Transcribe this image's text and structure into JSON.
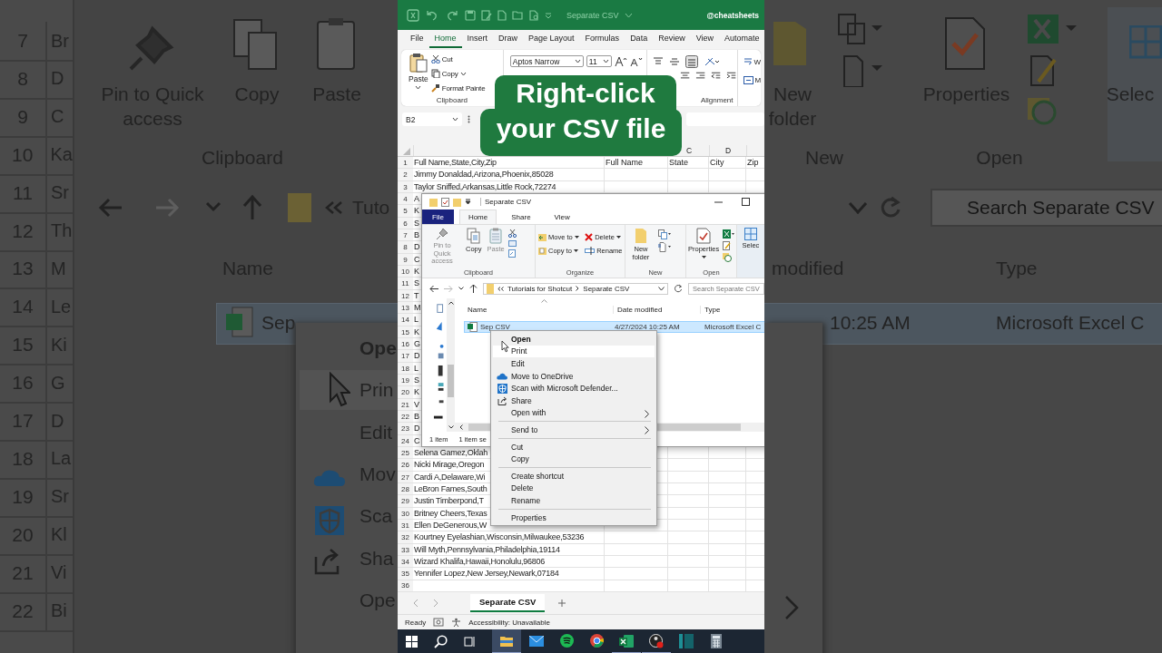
{
  "backdrop_left": {
    "rows": [
      {
        "number": "7",
        "text": "Br"
      },
      {
        "number": "8",
        "text": "D"
      },
      {
        "number": "9",
        "text": "C"
      },
      {
        "number": "10",
        "text": "Ka"
      },
      {
        "number": "11",
        "text": "Sr"
      },
      {
        "number": "12",
        "text": "Th"
      },
      {
        "number": "13",
        "text": "M"
      },
      {
        "number": "14",
        "text": "Le"
      },
      {
        "number": "15",
        "text": "Ki"
      },
      {
        "number": "16",
        "text": "G"
      },
      {
        "number": "17",
        "text": "D"
      },
      {
        "number": "18",
        "text": "La"
      },
      {
        "number": "19",
        "text": "Sr"
      },
      {
        "number": "20",
        "text": "Kl"
      },
      {
        "number": "21",
        "text": "Vi"
      },
      {
        "number": "22",
        "text": "Bi"
      }
    ],
    "labels": [
      "Pin to Quick access",
      "Copy",
      "Paste",
      "Clipboard",
      "Tuto",
      "Name",
      "Sep"
    ],
    "menu_items": [
      {
        "label": "Ope",
        "default": true,
        "highlighted": false
      },
      {
        "label": "Prin",
        "default": false,
        "highlighted": true
      },
      {
        "label": "Edit",
        "default": false,
        "highlighted": false
      },
      {
        "label": "Mov",
        "default": false,
        "highlighted": false
      },
      {
        "label": "Sca",
        "default": false,
        "highlighted": false
      },
      {
        "label": "Sha",
        "default": false,
        "highlighted": false
      },
      {
        "label": "Ope",
        "default": false,
        "highlighted": false
      }
    ]
  },
  "backdrop_right": {
    "labels": [
      "New folder",
      "Properties",
      "Selec",
      "New",
      "Open",
      "modified",
      "Type",
      "10:25 AM",
      "Microsoft Excel C"
    ],
    "search": {
      "placeholder": "Search Separate CSV"
    }
  },
  "excel": {
    "title": "Separate CSV",
    "account": "@cheatsheets",
    "menu_tabs": [
      {
        "label": "File",
        "selected": false
      },
      {
        "label": "Home",
        "selected": true
      },
      {
        "label": "Insert",
        "selected": false
      },
      {
        "label": "Draw",
        "selected": false
      },
      {
        "label": "Page Layout",
        "selected": false
      },
      {
        "label": "Formulas",
        "selected": false
      },
      {
        "label": "Data",
        "selected": false
      },
      {
        "label": "Review",
        "selected": false
      },
      {
        "label": "View",
        "selected": false
      },
      {
        "label": "Automate",
        "selected": false
      }
    ],
    "ribbon": {
      "paste": "Paste",
      "cut": "Cut",
      "copy": "Copy",
      "format_painter": "Format Painte",
      "clipboard_group": "Clipboard",
      "font": "Aptos Narrow",
      "font_size": "11",
      "wrap": "W",
      "merge": "M",
      "alignment_group": "Alignment"
    },
    "name_box": "B2",
    "column_headers": [
      "C",
      "D"
    ],
    "rows": [
      {
        "number": "1",
        "cells": [
          "Full Name,State,City,Zip",
          "Full Name",
          "State",
          "City",
          "Zip"
        ]
      },
      {
        "number": "2",
        "cells": [
          "Jimmy Donaldad,Arizona,Phoenix,85028"
        ]
      },
      {
        "number": "3",
        "cells": [
          "Taylor Sniffed,Arkansas,Little Rock,72274"
        ]
      },
      {
        "number": "4",
        "cells": [
          "A"
        ]
      },
      {
        "number": "5",
        "cells": [
          "K"
        ]
      },
      {
        "number": "6",
        "cells": [
          "S"
        ]
      },
      {
        "number": "7",
        "cells": [
          "B"
        ]
      },
      {
        "number": "8",
        "cells": [
          "D"
        ]
      },
      {
        "number": "9",
        "cells": [
          "C"
        ]
      },
      {
        "number": "10",
        "cells": [
          "K"
        ]
      },
      {
        "number": "11",
        "cells": [
          "S"
        ]
      },
      {
        "number": "12",
        "cells": [
          "T"
        ]
      },
      {
        "number": "13",
        "cells": [
          "M"
        ]
      },
      {
        "number": "14",
        "cells": [
          "L"
        ]
      },
      {
        "number": "15",
        "cells": [
          "K"
        ]
      },
      {
        "number": "16",
        "cells": [
          "G"
        ]
      },
      {
        "number": "17",
        "cells": [
          "D"
        ]
      },
      {
        "number": "18",
        "cells": [
          "L"
        ]
      },
      {
        "number": "19",
        "cells": [
          "S"
        ]
      },
      {
        "number": "20",
        "cells": [
          "K"
        ]
      },
      {
        "number": "21",
        "cells": [
          "V"
        ]
      },
      {
        "number": "22",
        "cells": [
          "B"
        ]
      },
      {
        "number": "23",
        "cells": [
          "D"
        ]
      },
      {
        "number": "24",
        "cells": [
          "C"
        ]
      },
      {
        "number": "25",
        "cells": [
          "Selena Gamez,Oklah"
        ]
      },
      {
        "number": "26",
        "cells": [
          "Nicki Mirage,Oregon"
        ]
      },
      {
        "number": "27",
        "cells": [
          "Cardi A,Delaware,Wi"
        ]
      },
      {
        "number": "28",
        "cells": [
          "LeBron Fames,South"
        ]
      },
      {
        "number": "29",
        "cells": [
          "Justin Timberpond,T"
        ]
      },
      {
        "number": "30",
        "cells": [
          "Britney Cheers,Texas"
        ]
      },
      {
        "number": "31",
        "cells": [
          "Ellen DeGenerous,W"
        ]
      },
      {
        "number": "32",
        "cells": [
          "Kourtney Eyelashian,Wisconsin,Milwaukee,53236"
        ]
      },
      {
        "number": "33",
        "cells": [
          "Will Myth,Pennsylvania,Philadelphia,19114"
        ]
      },
      {
        "number": "34",
        "cells": [
          "Wizard Khalifa,Hawaii,Honolulu,96806"
        ]
      },
      {
        "number": "35",
        "cells": [
          "Yennifer Lopez,New Jersey,Newark,07184"
        ]
      },
      {
        "number": "36",
        "cells": []
      }
    ],
    "sheet_tabs": [
      {
        "label": "Separate CSV",
        "selected": true
      }
    ],
    "status": {
      "ready": "Ready",
      "accessibility": "Accessibility: Unavailable"
    }
  },
  "explorer": {
    "title": "Separate CSV",
    "tabs": [
      {
        "label": "File",
        "kind": "file",
        "selected": false
      },
      {
        "label": "Home",
        "kind": "tab",
        "selected": true
      },
      {
        "label": "Share",
        "kind": "tab",
        "selected": false
      },
      {
        "label": "View",
        "kind": "tab",
        "selected": false
      }
    ],
    "ribbon": {
      "clipboard": {
        "buttons": [
          {
            "label": "Pin to Quick access",
            "disabled": true
          },
          {
            "label": "Copy",
            "disabled": false
          },
          {
            "label": "Paste",
            "disabled": true
          }
        ],
        "label": "Clipboard"
      },
      "organize": {
        "buttons": [
          {
            "label": "Move to",
            "disabled": false
          },
          {
            "label": "Delete",
            "disabled": false
          },
          {
            "label": "Copy to",
            "disabled": false
          },
          {
            "label": "Rename",
            "disabled": false
          }
        ],
        "label": "Organize"
      },
      "new": {
        "buttons": [
          {
            "label": "New folder",
            "disabled": false
          }
        ],
        "label": "New"
      },
      "open": {
        "buttons": [
          {
            "label": "Properties",
            "disabled": false
          }
        ],
        "label": "Open"
      },
      "select": {
        "buttons": [
          {
            "label": "Selec",
            "disabled": false
          }
        ]
      }
    },
    "path": [
      "Tutorials for Shotcut",
      "Separate CSV"
    ],
    "search": {
      "placeholder": "Search Separate CSV"
    },
    "columns": [
      "Name",
      "Date modified",
      "Type"
    ],
    "files": [
      {
        "name": "Sep CSV",
        "date": "4/27/2024 10:25 AM",
        "type": "Microsoft Excel C",
        "selected": true
      }
    ],
    "status": [
      "1 item",
      "1 item se"
    ]
  },
  "context_menu": {
    "items": [
      {
        "kind": "item",
        "label": "Open",
        "default": true,
        "highlighted": false,
        "submenu": false
      },
      {
        "kind": "item",
        "label": "Print",
        "default": false,
        "highlighted": true,
        "submenu": false
      },
      {
        "kind": "item",
        "label": "Edit",
        "default": false,
        "highlighted": false,
        "submenu": false
      },
      {
        "kind": "item",
        "label": "Move to OneDrive",
        "default": false,
        "highlighted": false,
        "submenu": false
      },
      {
        "kind": "item",
        "label": "Scan with Microsoft Defender...",
        "default": false,
        "highlighted": false,
        "submenu": false
      },
      {
        "kind": "item",
        "label": "Share",
        "default": false,
        "highlighted": false,
        "submenu": false
      },
      {
        "kind": "item",
        "label": "Open with",
        "default": false,
        "highlighted": false,
        "submenu": true
      },
      {
        "kind": "separator"
      },
      {
        "kind": "item",
        "label": "Send to",
        "default": false,
        "highlighted": false,
        "submenu": true
      },
      {
        "kind": "separator"
      },
      {
        "kind": "item",
        "label": "Cut",
        "default": false,
        "highlighted": false,
        "submenu": false
      },
      {
        "kind": "item",
        "label": "Copy",
        "default": false,
        "highlighted": false,
        "submenu": false
      },
      {
        "kind": "separator"
      },
      {
        "kind": "item",
        "label": "Create shortcut",
        "default": false,
        "highlighted": false,
        "submenu": false
      },
      {
        "kind": "item",
        "label": "Delete",
        "default": false,
        "highlighted": false,
        "submenu": false
      },
      {
        "kind": "item",
        "label": "Rename",
        "default": false,
        "highlighted": false,
        "submenu": false
      },
      {
        "kind": "separator"
      },
      {
        "kind": "item",
        "label": "Properties",
        "default": false,
        "highlighted": false,
        "submenu": false
      }
    ]
  },
  "caption": {
    "lines": [
      "Right-click",
      "your CSV file"
    ]
  },
  "taskbar": {
    "apps": [
      {
        "active": true,
        "running": true
      },
      {
        "active": false,
        "running": false
      },
      {
        "active": false,
        "running": false
      },
      {
        "active": false,
        "running": false
      },
      {
        "active": false,
        "running": true
      },
      {
        "active": false,
        "running": true
      },
      {
        "active": false,
        "running": false
      },
      {
        "active": false,
        "running": false
      }
    ]
  }
}
